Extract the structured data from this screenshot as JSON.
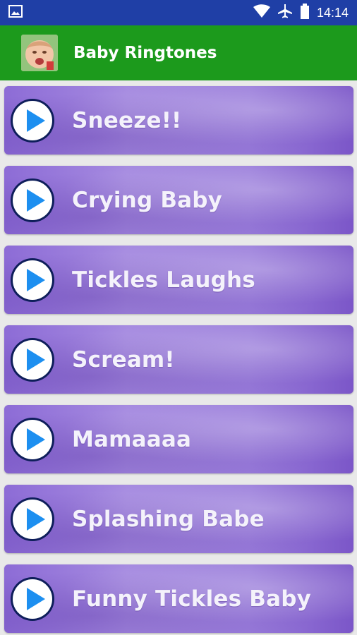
{
  "status_bar": {
    "time": "14:14",
    "icons": [
      "image-icon",
      "wifi-icon",
      "airplane-icon",
      "battery-icon"
    ]
  },
  "app_bar": {
    "title": "Baby Ringtones",
    "icon": "baby-face-icon"
  },
  "ringtones": [
    {
      "label": "Sneeze!!"
    },
    {
      "label": "Crying Baby"
    },
    {
      "label": "Tickles Laughs"
    },
    {
      "label": "Scream!"
    },
    {
      "label": "Mamaaaa"
    },
    {
      "label": "Splashing Babe"
    },
    {
      "label": "Funny Tickles Baby"
    }
  ],
  "colors": {
    "status_bar": "#1f3fa6",
    "app_bar": "#1c9a1c",
    "item": "#9a7ddb",
    "play_button": "#1d8ff0"
  }
}
